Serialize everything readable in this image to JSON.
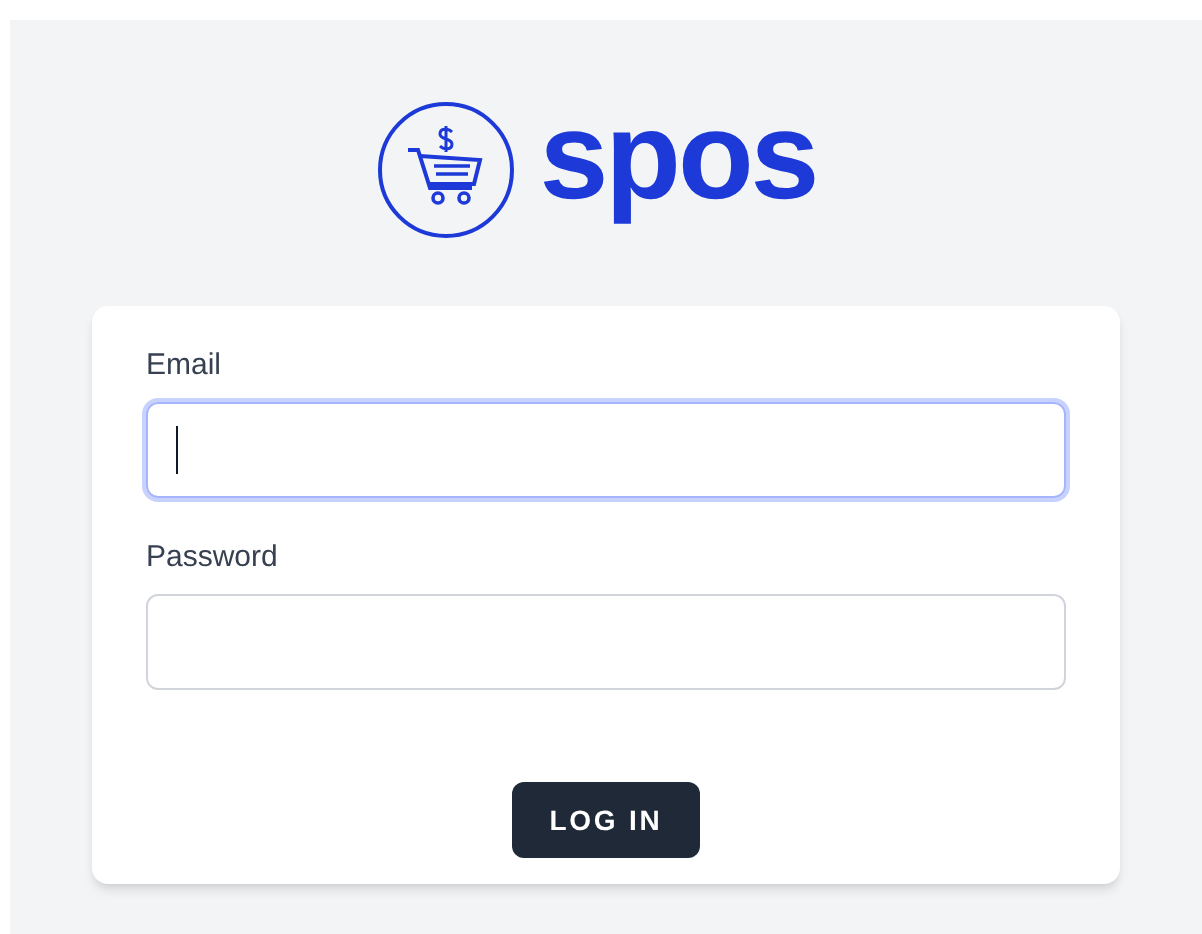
{
  "logo": {
    "text": "spos"
  },
  "form": {
    "fields": [
      {
        "label": "Email",
        "focused": true
      },
      {
        "label": "Password",
        "focused": false
      }
    ],
    "submit": "LOG IN"
  }
}
